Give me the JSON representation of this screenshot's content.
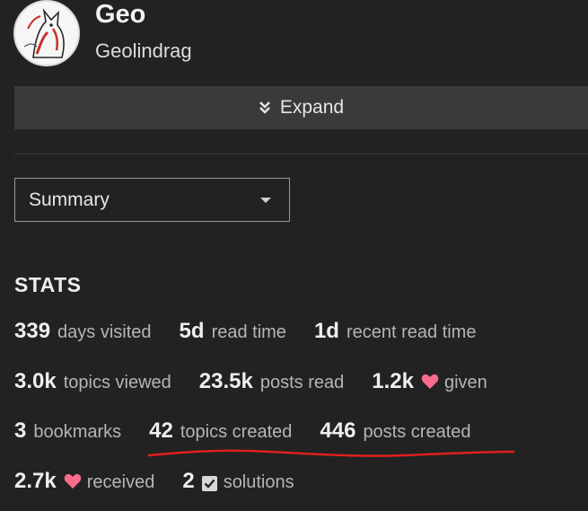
{
  "profile": {
    "display_name": "Geo",
    "username": "Geolindrag",
    "avatar_icon": "wolf-avatar-icon"
  },
  "expand": {
    "label": "Expand",
    "icon": "double-chevron-down-icon"
  },
  "view_select": {
    "selected": "Summary"
  },
  "stats": {
    "heading": "STATS",
    "rows": [
      [
        {
          "value": "339",
          "label": "days visited"
        },
        {
          "value": "5d",
          "label": "read time"
        },
        {
          "value": "1d",
          "label": "recent read time"
        }
      ],
      [
        {
          "value": "3.0k",
          "label": "topics viewed"
        },
        {
          "value": "23.5k",
          "label": "posts read"
        },
        {
          "value": "1.2k",
          "label": "given",
          "icon": "heart-icon"
        }
      ],
      [
        {
          "value": "3",
          "label": "bookmarks"
        },
        {
          "value": "42",
          "label": "topics created"
        },
        {
          "value": "446",
          "label": "posts created"
        }
      ],
      [
        {
          "value": "2.7k",
          "label": "received",
          "icon": "heart-icon"
        },
        {
          "value": "2",
          "label": "solutions",
          "icon": "checkbox-icon"
        }
      ]
    ]
  },
  "colors": {
    "background": "#222222",
    "heart": "#fa6c8d",
    "annotation": "#e0201c"
  }
}
